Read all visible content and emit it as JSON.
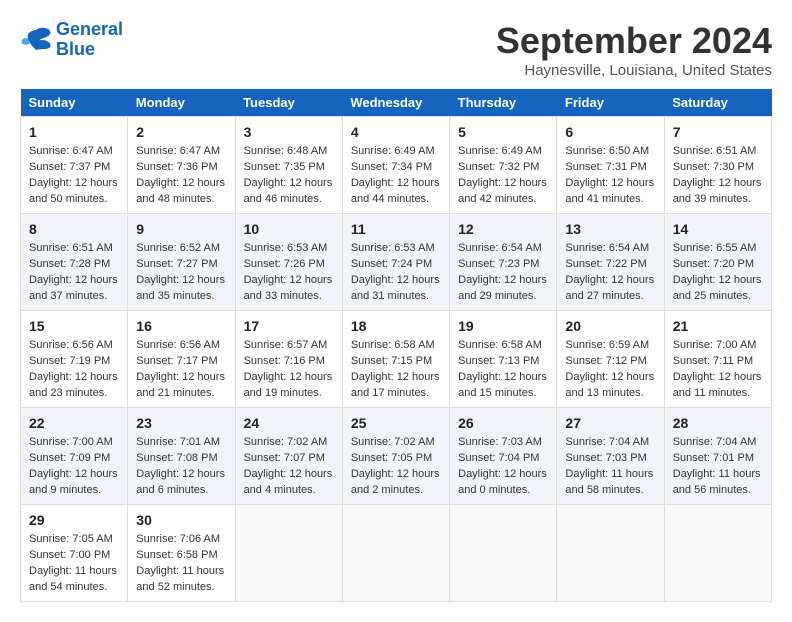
{
  "header": {
    "logo_line1": "General",
    "logo_line2": "Blue",
    "month": "September 2024",
    "location": "Haynesville, Louisiana, United States"
  },
  "weekdays": [
    "Sunday",
    "Monday",
    "Tuesday",
    "Wednesday",
    "Thursday",
    "Friday",
    "Saturday"
  ],
  "weeks": [
    [
      {
        "day": "1",
        "info": "Sunrise: 6:47 AM\nSunset: 7:37 PM\nDaylight: 12 hours\nand 50 minutes."
      },
      {
        "day": "2",
        "info": "Sunrise: 6:47 AM\nSunset: 7:36 PM\nDaylight: 12 hours\nand 48 minutes."
      },
      {
        "day": "3",
        "info": "Sunrise: 6:48 AM\nSunset: 7:35 PM\nDaylight: 12 hours\nand 46 minutes."
      },
      {
        "day": "4",
        "info": "Sunrise: 6:49 AM\nSunset: 7:34 PM\nDaylight: 12 hours\nand 44 minutes."
      },
      {
        "day": "5",
        "info": "Sunrise: 6:49 AM\nSunset: 7:32 PM\nDaylight: 12 hours\nand 42 minutes."
      },
      {
        "day": "6",
        "info": "Sunrise: 6:50 AM\nSunset: 7:31 PM\nDaylight: 12 hours\nand 41 minutes."
      },
      {
        "day": "7",
        "info": "Sunrise: 6:51 AM\nSunset: 7:30 PM\nDaylight: 12 hours\nand 39 minutes."
      }
    ],
    [
      {
        "day": "8",
        "info": "Sunrise: 6:51 AM\nSunset: 7:28 PM\nDaylight: 12 hours\nand 37 minutes."
      },
      {
        "day": "9",
        "info": "Sunrise: 6:52 AM\nSunset: 7:27 PM\nDaylight: 12 hours\nand 35 minutes."
      },
      {
        "day": "10",
        "info": "Sunrise: 6:53 AM\nSunset: 7:26 PM\nDaylight: 12 hours\nand 33 minutes."
      },
      {
        "day": "11",
        "info": "Sunrise: 6:53 AM\nSunset: 7:24 PM\nDaylight: 12 hours\nand 31 minutes."
      },
      {
        "day": "12",
        "info": "Sunrise: 6:54 AM\nSunset: 7:23 PM\nDaylight: 12 hours\nand 29 minutes."
      },
      {
        "day": "13",
        "info": "Sunrise: 6:54 AM\nSunset: 7:22 PM\nDaylight: 12 hours\nand 27 minutes."
      },
      {
        "day": "14",
        "info": "Sunrise: 6:55 AM\nSunset: 7:20 PM\nDaylight: 12 hours\nand 25 minutes."
      }
    ],
    [
      {
        "day": "15",
        "info": "Sunrise: 6:56 AM\nSunset: 7:19 PM\nDaylight: 12 hours\nand 23 minutes."
      },
      {
        "day": "16",
        "info": "Sunrise: 6:56 AM\nSunset: 7:17 PM\nDaylight: 12 hours\nand 21 minutes."
      },
      {
        "day": "17",
        "info": "Sunrise: 6:57 AM\nSunset: 7:16 PM\nDaylight: 12 hours\nand 19 minutes."
      },
      {
        "day": "18",
        "info": "Sunrise: 6:58 AM\nSunset: 7:15 PM\nDaylight: 12 hours\nand 17 minutes."
      },
      {
        "day": "19",
        "info": "Sunrise: 6:58 AM\nSunset: 7:13 PM\nDaylight: 12 hours\nand 15 minutes."
      },
      {
        "day": "20",
        "info": "Sunrise: 6:59 AM\nSunset: 7:12 PM\nDaylight: 12 hours\nand 13 minutes."
      },
      {
        "day": "21",
        "info": "Sunrise: 7:00 AM\nSunset: 7:11 PM\nDaylight: 12 hours\nand 11 minutes."
      }
    ],
    [
      {
        "day": "22",
        "info": "Sunrise: 7:00 AM\nSunset: 7:09 PM\nDaylight: 12 hours\nand 9 minutes."
      },
      {
        "day": "23",
        "info": "Sunrise: 7:01 AM\nSunset: 7:08 PM\nDaylight: 12 hours\nand 6 minutes."
      },
      {
        "day": "24",
        "info": "Sunrise: 7:02 AM\nSunset: 7:07 PM\nDaylight: 12 hours\nand 4 minutes."
      },
      {
        "day": "25",
        "info": "Sunrise: 7:02 AM\nSunset: 7:05 PM\nDaylight: 12 hours\nand 2 minutes."
      },
      {
        "day": "26",
        "info": "Sunrise: 7:03 AM\nSunset: 7:04 PM\nDaylight: 12 hours\nand 0 minutes."
      },
      {
        "day": "27",
        "info": "Sunrise: 7:04 AM\nSunset: 7:03 PM\nDaylight: 11 hours\nand 58 minutes."
      },
      {
        "day": "28",
        "info": "Sunrise: 7:04 AM\nSunset: 7:01 PM\nDaylight: 11 hours\nand 56 minutes."
      }
    ],
    [
      {
        "day": "29",
        "info": "Sunrise: 7:05 AM\nSunset: 7:00 PM\nDaylight: 11 hours\nand 54 minutes."
      },
      {
        "day": "30",
        "info": "Sunrise: 7:06 AM\nSunset: 6:58 PM\nDaylight: 11 hours\nand 52 minutes."
      },
      {
        "day": "",
        "info": ""
      },
      {
        "day": "",
        "info": ""
      },
      {
        "day": "",
        "info": ""
      },
      {
        "day": "",
        "info": ""
      },
      {
        "day": "",
        "info": ""
      }
    ]
  ]
}
